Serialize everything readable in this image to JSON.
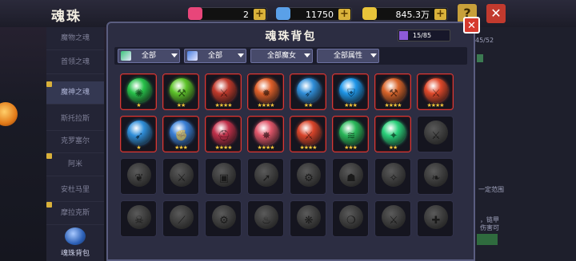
{
  "header": {
    "title": "魂珠",
    "resources": [
      {
        "value": "2",
        "color": "#e8467a"
      },
      {
        "value": "11750",
        "color": "#5aa0e8"
      },
      {
        "value": "845.3万",
        "color": "#e8c43a"
      }
    ],
    "help_label": "?",
    "exit_label": "✕"
  },
  "sidebar": {
    "items": [
      {
        "label": "魔物之魂"
      },
      {
        "label": "首领之魂"
      },
      {
        "label": "魔神之魂"
      },
      {
        "label": "斯托拉斯"
      },
      {
        "label": "克罗塞尔"
      },
      {
        "label": "阿米"
      },
      {
        "label": "安杜马里"
      },
      {
        "label": "摩拉克斯"
      }
    ],
    "bottom_label": "魂珠背包"
  },
  "right_panel": {
    "count": "45/52",
    "text1": "一定范围",
    "text2": "，链甲",
    "text3": "伤害可"
  },
  "dialog": {
    "title": "魂珠背包",
    "capacity": {
      "text": "15/85",
      "fraction": 0.176
    },
    "close_label": "✕",
    "filters": [
      {
        "label": "全部",
        "icon_color": "#3bc47a"
      },
      {
        "label": "全部",
        "icon_color": "#4a7fe0"
      },
      {
        "label": "全部魔女"
      },
      {
        "label": "全部属性"
      }
    ]
  },
  "orbs": [
    {
      "owned": true,
      "color": "#27c24a",
      "icon": "whirlwind-icon",
      "stars": "★"
    },
    {
      "owned": true,
      "color": "#5ec42a",
      "icon": "mace-icon",
      "stars": "★★"
    },
    {
      "owned": true,
      "color": "#c0392b",
      "icon": "axe-icon",
      "stars": "★★★★"
    },
    {
      "owned": true,
      "color": "#e0602a",
      "icon": "flail-icon",
      "stars": "★★★★"
    },
    {
      "owned": true,
      "color": "#2f8ed9",
      "icon": "bow-icon",
      "stars": "★★"
    },
    {
      "owned": true,
      "color": "#1e96e8",
      "icon": "shield-chain-icon",
      "stars": "★★★"
    },
    {
      "owned": true,
      "color": "#d9642a",
      "icon": "hammer-icon",
      "stars": "★★★★"
    },
    {
      "owned": true,
      "color": "#e0482a",
      "icon": "sword-icon",
      "stars": "★★★★"
    },
    {
      "owned": true,
      "color": "#2f8ed9",
      "icon": "lance-icon",
      "stars": "★"
    },
    {
      "owned": true,
      "color": "#3a7fd6",
      "icon": "fist-icon",
      "stars": "★★★"
    },
    {
      "owned": true,
      "color": "#c0304a",
      "icon": "helm-icon",
      "stars": "★★★★"
    },
    {
      "owned": true,
      "color": "#e0566a",
      "icon": "burst-icon",
      "stars": "★★★★"
    },
    {
      "owned": true,
      "color": "#d9442a",
      "icon": "blade-icon",
      "stars": "★★★★"
    },
    {
      "owned": true,
      "color": "#2ab85a",
      "icon": "wave-icon",
      "stars": "★★★"
    },
    {
      "owned": true,
      "color": "#2ad07a",
      "icon": "spirit-icon",
      "stars": "★★"
    },
    {
      "owned": false,
      "icon": "axe-icon"
    },
    {
      "owned": false,
      "icon": "dragon-icon"
    },
    {
      "owned": false,
      "icon": "sword-icon"
    },
    {
      "owned": false,
      "icon": "box-icon"
    },
    {
      "owned": false,
      "icon": "arrow-icon"
    },
    {
      "owned": false,
      "icon": "gear-icon"
    },
    {
      "owned": false,
      "icon": "mask-icon"
    },
    {
      "owned": false,
      "icon": "claw-icon"
    },
    {
      "owned": false,
      "icon": "wing-icon"
    },
    {
      "owned": false,
      "icon": "skull-icon"
    },
    {
      "owned": false,
      "icon": "spear-icon"
    },
    {
      "owned": false,
      "icon": "gear-icon"
    },
    {
      "owned": false,
      "icon": "torch-icon"
    },
    {
      "owned": false,
      "icon": "knot-icon"
    },
    {
      "owned": false,
      "icon": "drop-icon"
    },
    {
      "owned": false,
      "icon": "blade-icon"
    },
    {
      "owned": false,
      "icon": "cross-icon"
    }
  ]
}
